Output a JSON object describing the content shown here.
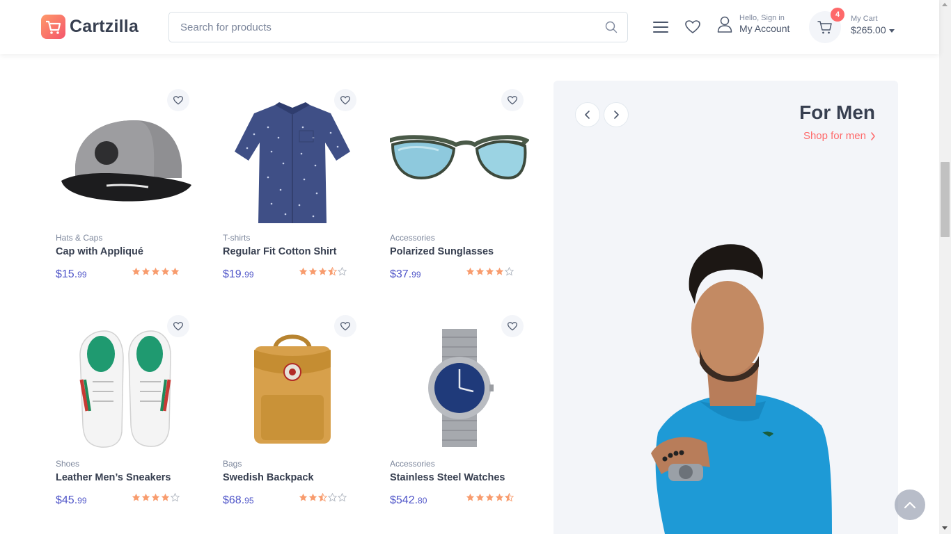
{
  "header": {
    "logo_text": "Cartzilla",
    "search_placeholder": "Search for products",
    "account_greeting": "Hello, Sign in",
    "account_label": "My Account",
    "cart_label": "My Cart",
    "cart_total": "$265.00",
    "cart_count": "4"
  },
  "products": [
    {
      "category": "Hats & Caps",
      "name": "Cap with Appliqué",
      "price_main": "$15.",
      "price_cents": "99",
      "rating": 5
    },
    {
      "category": "T-shirts",
      "name": "Regular Fit Cotton Shirt",
      "price_main": "$19.",
      "price_cents": "99",
      "rating": 3.5
    },
    {
      "category": "Accessories",
      "name": "Polarized Sunglasses",
      "price_main": "$37.",
      "price_cents": "99",
      "rating": 4
    },
    {
      "category": "Shoes",
      "name": "Leather Men’s Sneakers",
      "price_main": "$45.",
      "price_cents": "99",
      "rating": 4
    },
    {
      "category": "Bags",
      "name": "Swedish Backpack",
      "price_main": "$68.",
      "price_cents": "95",
      "rating": 2.5
    },
    {
      "category": "Accessories",
      "name": "Stainless Steel Watches",
      "price_main": "$542.",
      "price_cents": "80",
      "rating": 4.5
    }
  ],
  "promo": {
    "title": "For Men",
    "link_label": "Shop for men"
  },
  "colors": {
    "accent": "#fe696a",
    "price": "#4e54c8",
    "star": "#f89c6e",
    "star_empty": "#aeb4be"
  }
}
